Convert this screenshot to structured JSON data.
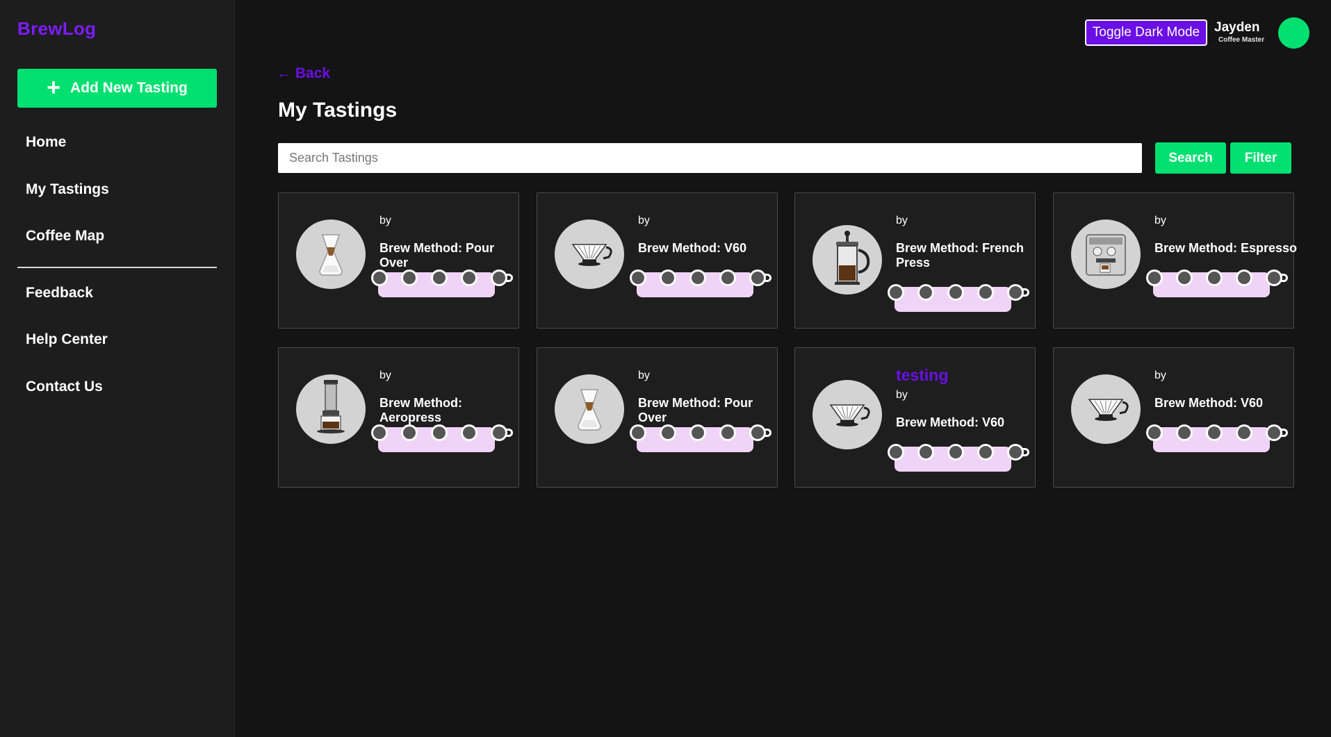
{
  "app": {
    "logo": "BrewLog",
    "add_button_label": "Add New Tasting",
    "add_button_icon": "plus-icon"
  },
  "sidebar": {
    "nav_primary": [
      {
        "label": "Home"
      },
      {
        "label": "My Tastings"
      },
      {
        "label": "Coffee Map"
      }
    ],
    "nav_secondary": [
      {
        "label": "Feedback"
      },
      {
        "label": "Help Center"
      },
      {
        "label": "Contact Us"
      }
    ]
  },
  "header": {
    "toggle_label": "Toggle Dark Mode",
    "user_name": "Jayden",
    "user_role": "Coffee Master",
    "avatar_color": "#00e070"
  },
  "main": {
    "back_label": "← Back",
    "title": "My Tastings",
    "search_placeholder": "Search Tastings",
    "search_button": "Search",
    "filter_button": "Filter"
  },
  "colors": {
    "accent_green": "#00e070",
    "brand_purple": "#6a0fe5",
    "rating_bar": "#f0d4f7"
  },
  "tastings": [
    {
      "name": "",
      "by": "by",
      "method": "Brew Method: Pour Over",
      "icon": "chemex-icon",
      "cups": 5
    },
    {
      "name": "",
      "by": "by",
      "method": "Brew Method: V60",
      "icon": "v60-dripper-icon",
      "cups": 5
    },
    {
      "name": "",
      "by": "by",
      "method": "Brew Method: French Press",
      "icon": "french-press-icon",
      "cups": 5
    },
    {
      "name": "",
      "by": "by",
      "method": "Brew Method: Espresso",
      "icon": "espresso-machine-icon",
      "cups": 5
    },
    {
      "name": "",
      "by": "by",
      "method": "Brew Method: Aeropress",
      "icon": "aeropress-icon",
      "cups": 5
    },
    {
      "name": "",
      "by": "by",
      "method": "Brew Method: Pour Over",
      "icon": "chemex-icon",
      "cups": 5
    },
    {
      "name": "testing",
      "by": "by",
      "method": "Brew Method: V60",
      "icon": "v60-dripper-icon",
      "cups": 5
    },
    {
      "name": "",
      "by": "by",
      "method": "Brew Method: V60",
      "icon": "v60-dripper-icon",
      "cups": 5
    }
  ]
}
